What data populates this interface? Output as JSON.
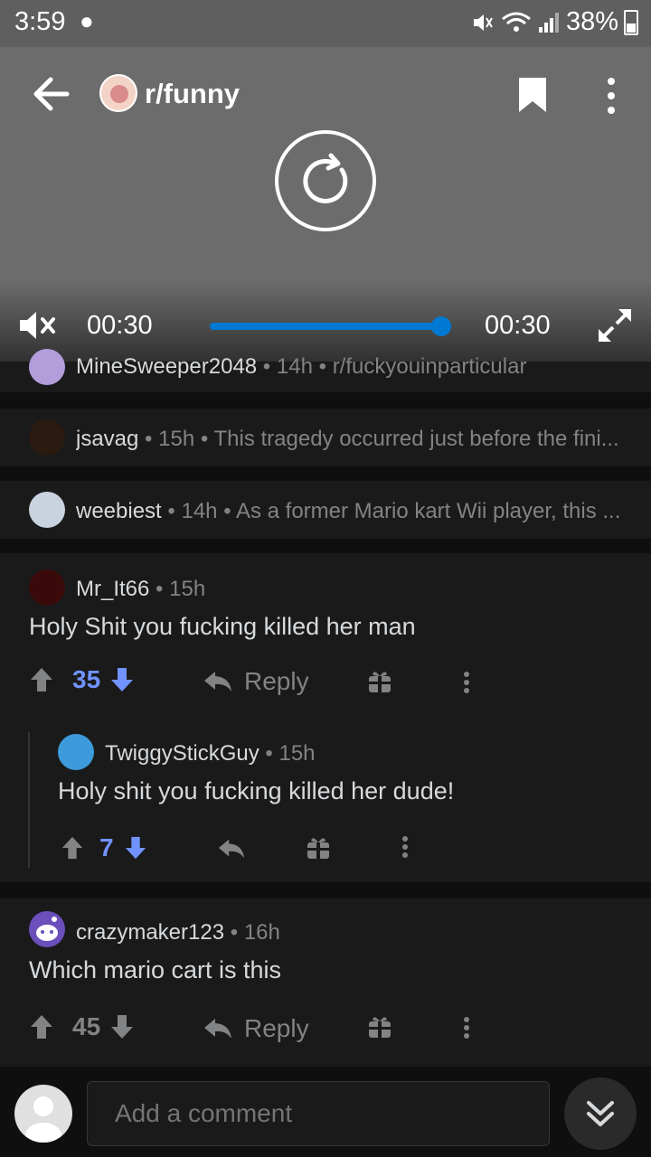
{
  "status_bar": {
    "time": "3:59",
    "battery": "38%"
  },
  "video": {
    "subreddit": "r/funny",
    "current_time": "00:30",
    "total_time": "00:30",
    "progress": 1.0
  },
  "collapsed_comments": [
    {
      "username": "MineSweeper2048",
      "age": "14h",
      "preview": "r/fuckyouinparticular"
    },
    {
      "username": "jsavag",
      "age": "15h",
      "preview": "This tragedy occurred just before the fini..."
    },
    {
      "username": "weebiest",
      "age": "14h",
      "preview": "As a former Mario kart Wii player, this ..."
    }
  ],
  "comments": [
    {
      "username": "Mr_It66",
      "age": "15h",
      "text": "Holy Shit you fucking killed her man",
      "score": "35",
      "reply_label": "Reply"
    },
    {
      "username": "TwiggyStickGuy",
      "age": "15h",
      "text": "Holy shit you fucking killed her dude!",
      "score": "7"
    },
    {
      "username": "crazymaker123",
      "age": "16h",
      "text": "Which mario cart is this",
      "score": "45",
      "reply_label": "Reply"
    }
  ],
  "composer": {
    "placeholder": "Add a comment"
  },
  "colors": {
    "upvoted_blue": "#7193ff",
    "accent": "#0079d3",
    "background": "#1a1a1b",
    "muted": "#818384"
  },
  "icons": [
    "back-arrow-icon",
    "bookmark-icon",
    "more-vertical-icon",
    "replay-icon",
    "mute-icon",
    "fullscreen-icon",
    "upvote-icon",
    "downvote-icon",
    "reply-icon",
    "award-icon",
    "chevron-double-down-icon"
  ]
}
